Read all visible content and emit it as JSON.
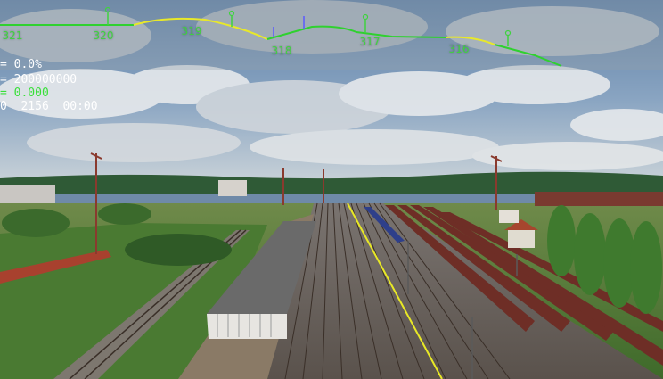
{
  "colors": {
    "profile_flat": "#2fd12f",
    "profile_grade": "#e8e82a",
    "milepost": "#3fd23f",
    "signal_marker": "#5a5aff",
    "hud_text": "#ffffff",
    "hud_text_highlight": "#39e039"
  },
  "track_profile": {
    "mileposts": [
      "321",
      "320",
      "319",
      "318",
      "317",
      "316"
    ]
  },
  "hud": {
    "grade": "= 0.0%",
    "counter": "= 200000000",
    "value_green": "= 0.000",
    "status": "0  2156  00:00"
  }
}
